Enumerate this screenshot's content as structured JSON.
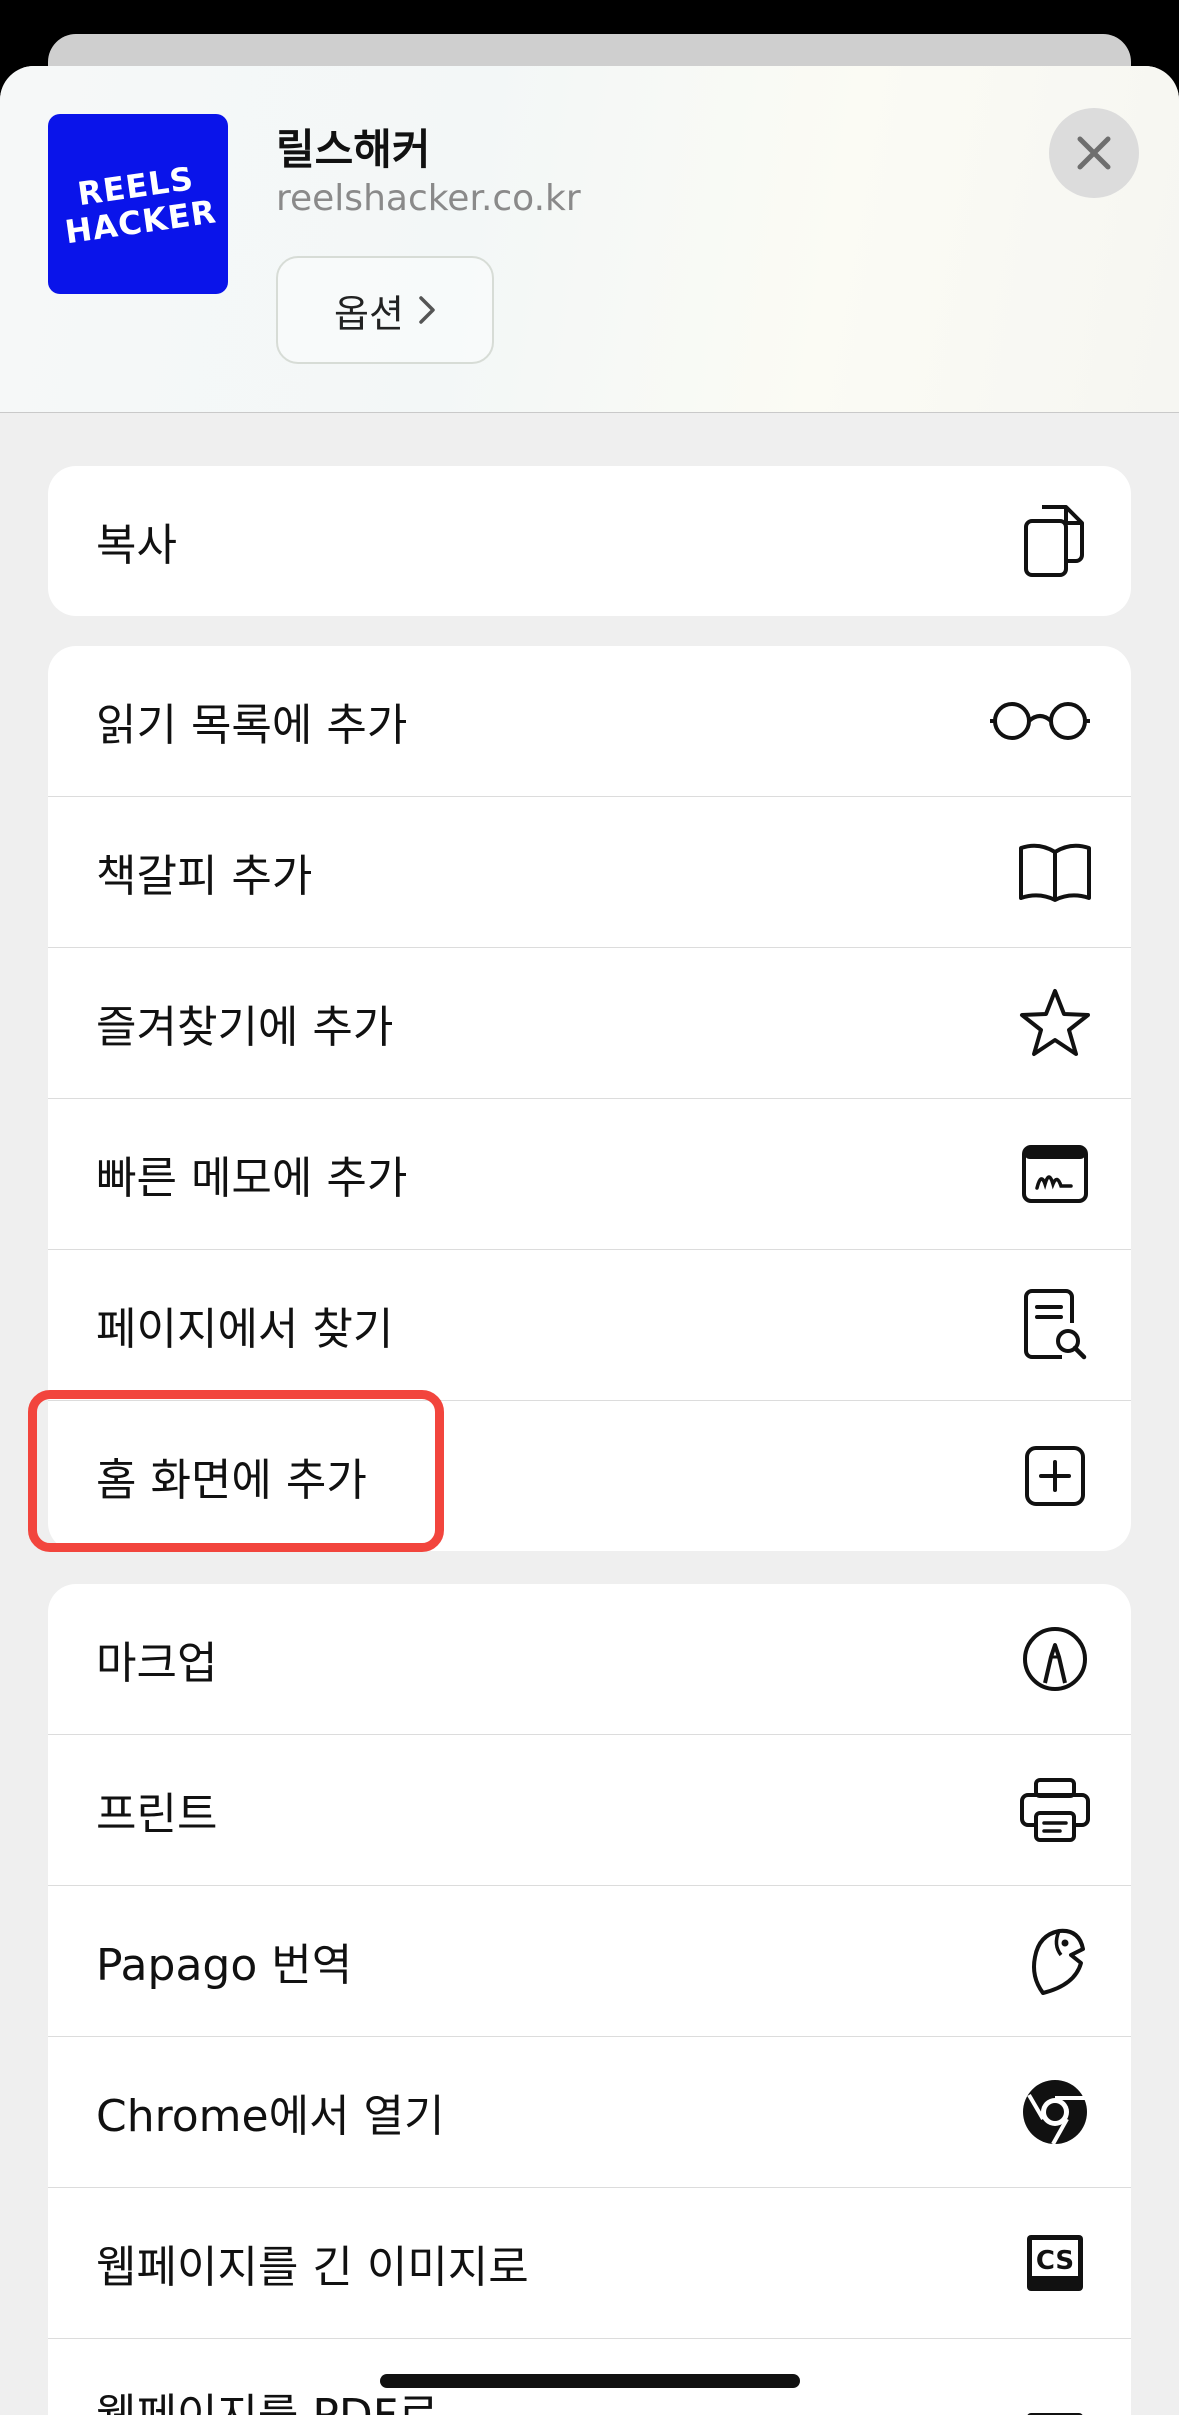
{
  "header": {
    "app_icon_text": "REELS\nHACKER",
    "app_name": "릴스해커",
    "app_url": "reelshacker.co.kr",
    "options_label": "옵션"
  },
  "groups": [
    {
      "items": [
        {
          "label": "복사",
          "icon": "copy-icon"
        }
      ]
    },
    {
      "items": [
        {
          "label": "읽기 목록에 추가",
          "icon": "glasses-icon"
        },
        {
          "label": "책갈피 추가",
          "icon": "book-icon"
        },
        {
          "label": "즐겨찾기에 추가",
          "icon": "star-icon"
        },
        {
          "label": "빠른 메모에 추가",
          "icon": "quick-note-icon"
        },
        {
          "label": "페이지에서 찾기",
          "icon": "find-in-page-icon"
        },
        {
          "label": "홈 화면에 추가",
          "icon": "add-square-icon"
        }
      ]
    },
    {
      "items": [
        {
          "label": "마크업",
          "icon": "markup-icon"
        },
        {
          "label": "프린트",
          "icon": "printer-icon"
        },
        {
          "label": "Papago 번역",
          "icon": "papago-bird-icon"
        },
        {
          "label": "Chrome에서 열기",
          "icon": "chrome-icon"
        },
        {
          "label": "웹페이지를 긴 이미지로",
          "icon": "cs-icon"
        },
        {
          "label": "웹페이지를 PDF로",
          "icon": "cs-icon"
        }
      ]
    }
  ],
  "colors": {
    "highlight": "#f2453d",
    "app_icon_bg": "#0a14ea"
  }
}
